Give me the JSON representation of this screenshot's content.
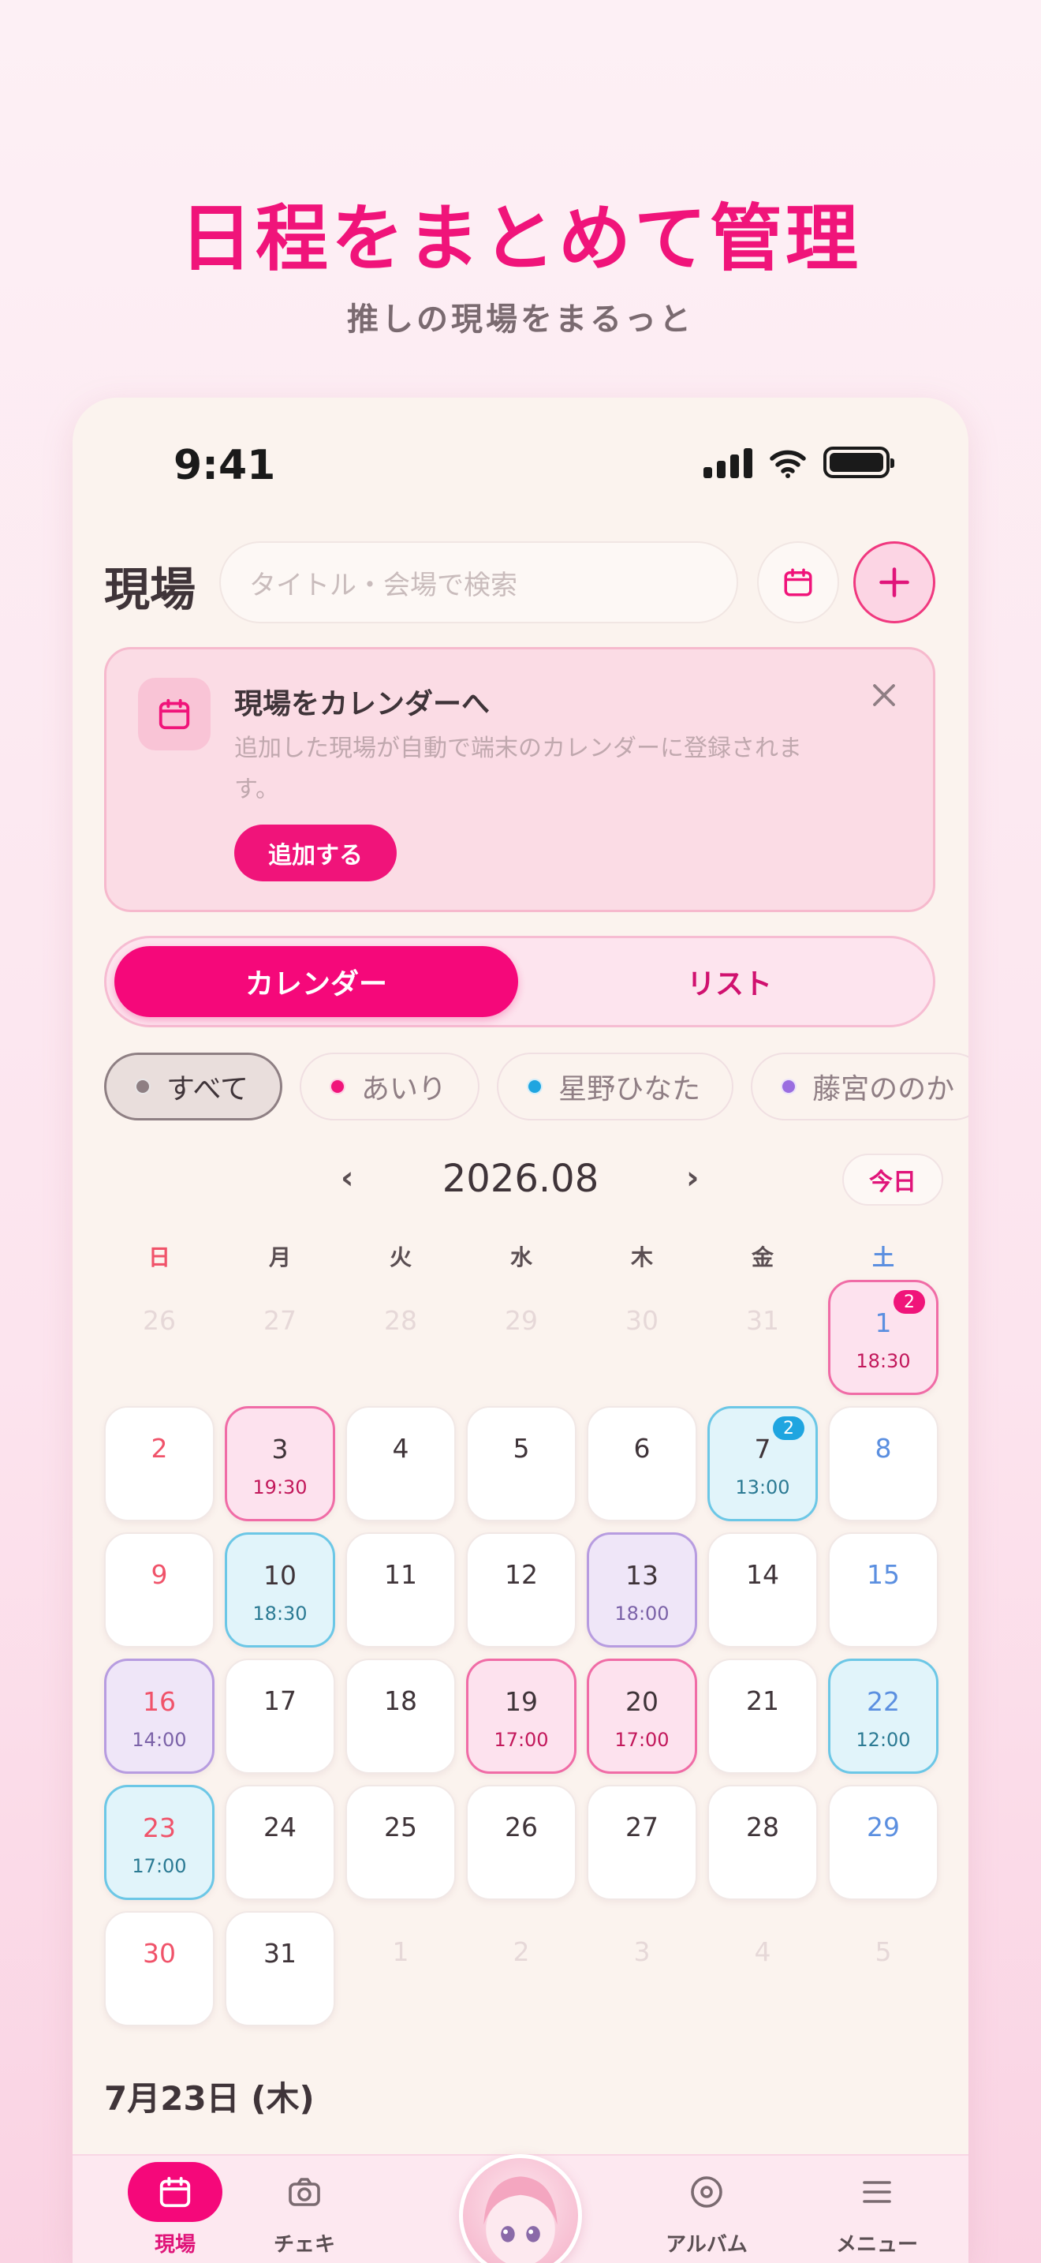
{
  "hero": {
    "title": "日程をまとめて管理",
    "subtitle": "推しの現場をまるっと"
  },
  "status_bar": {
    "time": "9:41",
    "icons": [
      "cellular-signal-icon",
      "wifi-icon",
      "battery-icon"
    ]
  },
  "header": {
    "title": "現場",
    "search_placeholder": "タイトル・会場で検索",
    "calendar_button_icon": "calendar-icon",
    "add_button_icon": "plus-icon"
  },
  "banner": {
    "title": "現場をカレンダーへ",
    "body": "追加した現場が自動で端末のカレンダーに登録されます。",
    "action_label": "追加する",
    "icon": "calendar-icon",
    "close_icon": "close-icon"
  },
  "view_toggle": {
    "active": "カレンダー",
    "inactive": "リスト"
  },
  "filters": [
    {
      "label": "すべて",
      "color": "#8e7f83",
      "active": true
    },
    {
      "label": "あいり",
      "color": "#f0147a",
      "active": false
    },
    {
      "label": "星野ひなた",
      "color": "#1fa5e0",
      "active": false
    },
    {
      "label": "藤宮ののか",
      "color": "#9a6de0",
      "active": false
    }
  ],
  "calendar": {
    "month_label": "2026.08",
    "prev_icon": "‹",
    "next_icon": "›",
    "today_label": "今日",
    "weekdays": [
      "日",
      "月",
      "火",
      "水",
      "木",
      "金",
      "土"
    ],
    "weeks": [
      [
        {
          "day": "26",
          "muted": true
        },
        {
          "day": "27",
          "muted": true
        },
        {
          "day": "28",
          "muted": true
        },
        {
          "day": "29",
          "muted": true
        },
        {
          "day": "30",
          "muted": true
        },
        {
          "day": "31",
          "muted": true
        },
        {
          "day": "1",
          "time": "18:30",
          "tint": "pink",
          "badge": "2",
          "badge_color": "#f0147a"
        }
      ],
      [
        {
          "day": "2"
        },
        {
          "day": "3",
          "time": "19:30",
          "tint": "pink"
        },
        {
          "day": "4"
        },
        {
          "day": "5"
        },
        {
          "day": "6"
        },
        {
          "day": "7",
          "time": "13:00",
          "tint": "blue",
          "badge": "2",
          "badge_color": "#1fa5e0"
        },
        {
          "day": "8"
        }
      ],
      [
        {
          "day": "9"
        },
        {
          "day": "10",
          "time": "18:30",
          "tint": "blue"
        },
        {
          "day": "11"
        },
        {
          "day": "12"
        },
        {
          "day": "13",
          "time": "18:00",
          "tint": "purple"
        },
        {
          "day": "14"
        },
        {
          "day": "15"
        }
      ],
      [
        {
          "day": "16",
          "time": "14:00",
          "tint": "purple"
        },
        {
          "day": "17"
        },
        {
          "day": "18"
        },
        {
          "day": "19",
          "time": "17:00",
          "tint": "pink"
        },
        {
          "day": "20",
          "time": "17:00",
          "tint": "pink"
        },
        {
          "day": "21"
        },
        {
          "day": "22",
          "time": "12:00",
          "tint": "blue"
        }
      ],
      [
        {
          "day": "23",
          "time": "17:00",
          "tint": "blue"
        },
        {
          "day": "24"
        },
        {
          "day": "25"
        },
        {
          "day": "26"
        },
        {
          "day": "27"
        },
        {
          "day": "28"
        },
        {
          "day": "29"
        }
      ],
      [
        {
          "day": "30"
        },
        {
          "day": "31"
        },
        {
          "day": "1",
          "muted": true
        },
        {
          "day": "2",
          "muted": true
        },
        {
          "day": "3",
          "muted": true
        },
        {
          "day": "4",
          "muted": true
        },
        {
          "day": "5",
          "muted": true
        }
      ]
    ]
  },
  "selected_date": "7月23日 (木)",
  "tab_bar": {
    "items": [
      {
        "label": "現場",
        "icon": "calendar-icon",
        "active": true
      },
      {
        "label": "チェキ",
        "icon": "camera-icon",
        "active": false
      },
      {
        "label": "アルバム",
        "icon": "album-icon",
        "active": false
      },
      {
        "label": "メニュー",
        "icon": "menu-icon",
        "active": false
      }
    ],
    "center_avatar": "avatar-icon"
  },
  "colors": {
    "accent": "#f0147a",
    "pink_tint": "#fde2ee",
    "blue_tint": "#e1f4fa",
    "purple_tint": "#efe6f8"
  }
}
